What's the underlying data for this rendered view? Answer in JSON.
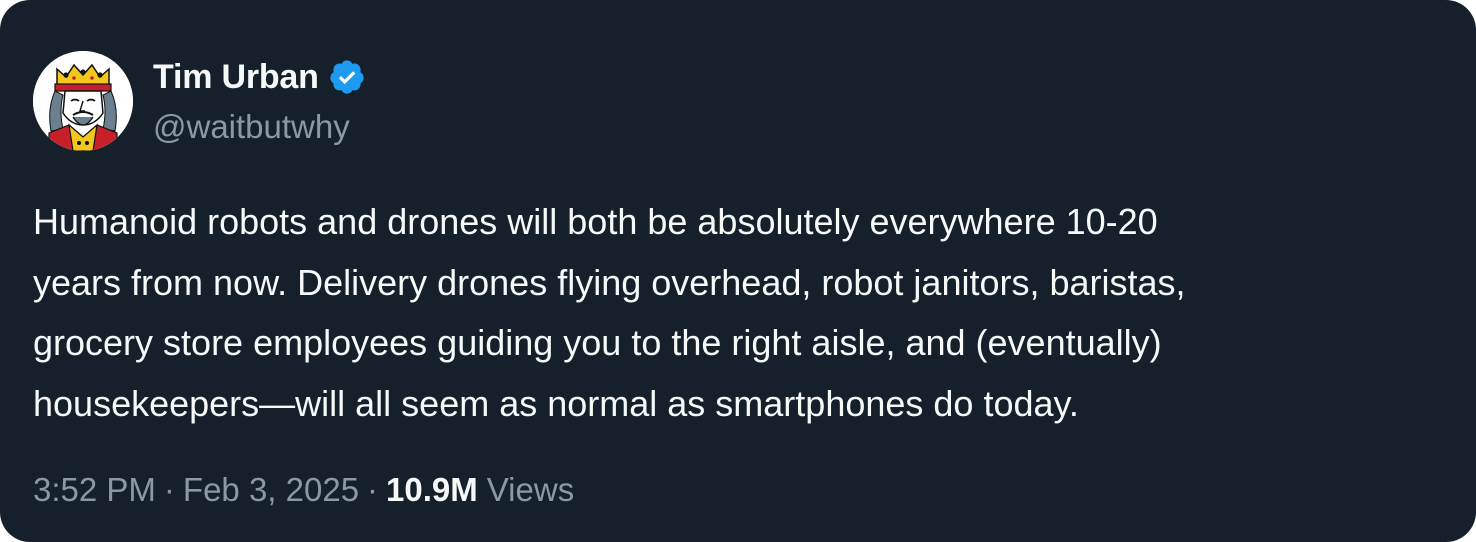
{
  "tweet": {
    "author": {
      "display_name": "Tim Urban",
      "handle": "@waitbutwhy",
      "verified": true,
      "verified_icon": "verified-badge-icon",
      "avatar_icon": "king-of-clubs-card-icon"
    },
    "text_lines": [
      "Humanoid robots and drones will both be absolutely everywhere 10-20",
      "years from now. Delivery drones flying overhead, robot janitors, baristas,",
      "grocery store employees guiding you to the right aisle, and (eventually)",
      "housekeepers—will all seem as normal as smartphones do today."
    ],
    "time": "3:52 PM",
    "separator": "·",
    "date": "Feb 3, 2025",
    "views_count": "10.9M",
    "views_label": "Views"
  },
  "colors": {
    "background": "#15202b",
    "text_primary": "#f7f9f9",
    "text_secondary": "#8b98a5",
    "verified_blue": "#1d9bf0"
  }
}
